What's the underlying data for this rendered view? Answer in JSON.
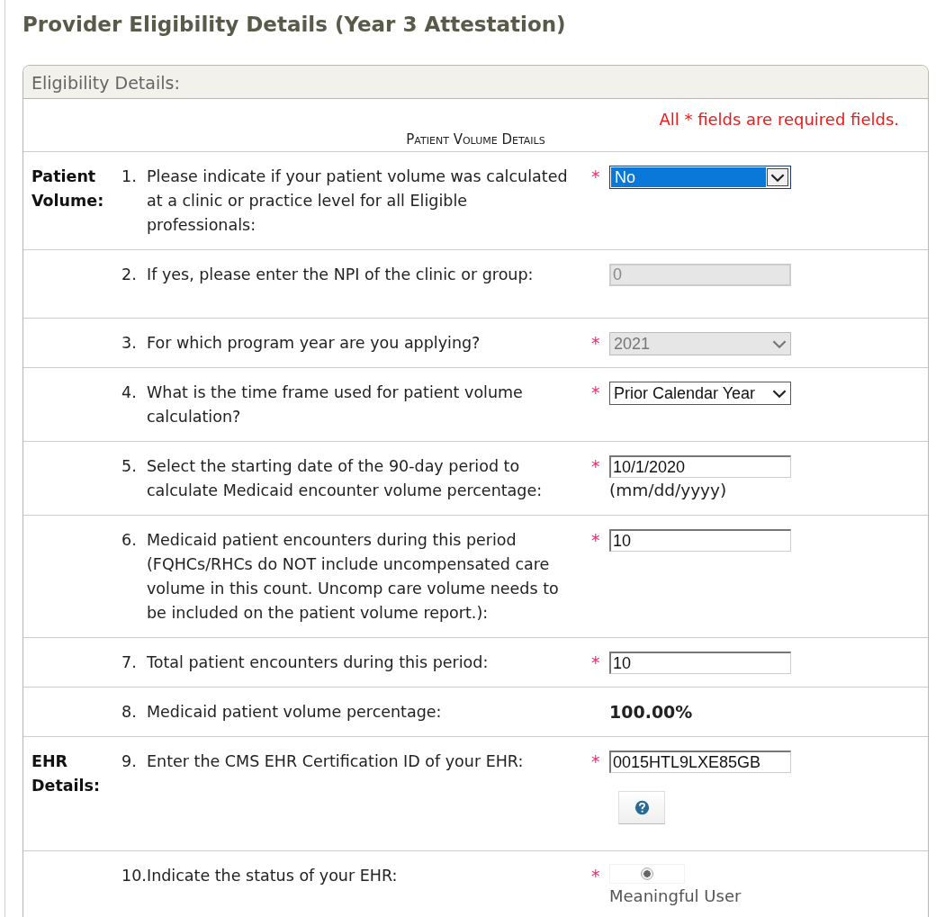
{
  "page_title": "Provider Eligibility Details (Year 3 Attestation)",
  "panel": {
    "title": "Eligibility Details:",
    "required_note": "All * fields are required fields.",
    "section_heading": "Patient Volume Details",
    "rows": [
      {
        "section": "Patient Volume:",
        "number": "1.",
        "question": "Please indicate if your patient volume was calculated at a clinic or practice level for all Eligible professionals:",
        "required_mark": "*",
        "control": {
          "kind": "select",
          "value": "No",
          "disabled": false,
          "focused": true
        }
      },
      {
        "number": "2.",
        "question": "If yes, please enter the NPI of the clinic or group:",
        "control": {
          "kind": "text",
          "value": "0",
          "disabled": true
        }
      },
      {
        "number": "3.",
        "question": "For which program year are you applying?",
        "required_mark": "*",
        "control": {
          "kind": "select",
          "value": "2021",
          "disabled": true,
          "focused": false
        }
      },
      {
        "number": "4.",
        "question": "What is the time frame used for patient volume calculation?",
        "required_mark": "*",
        "control": {
          "kind": "select",
          "value": "Prior Calendar Year",
          "disabled": false,
          "focused": false
        }
      },
      {
        "number": "5.",
        "question": "Select the starting date of the 90-day period to calculate Medicaid encounter volume percentage:",
        "required_mark": "*",
        "control": {
          "kind": "text",
          "value": "10/1/2020",
          "disabled": false,
          "hint": "(mm/dd/yyyy)"
        }
      },
      {
        "number": "6.",
        "question": "Medicaid patient encounters during this period (FQHCs/RHCs do NOT include uncompensated care volume in this count. Uncomp care volume needs to be included on the patient volume report.):",
        "required_mark": "*",
        "control": {
          "kind": "text",
          "value": "10",
          "disabled": false
        }
      },
      {
        "number": "7.",
        "question": "Total patient encounters during this period:",
        "required_mark": "*",
        "control": {
          "kind": "text",
          "value": "10",
          "disabled": false
        }
      },
      {
        "number": "8.",
        "question": "Medicaid patient volume percentage:",
        "control": {
          "kind": "static",
          "value": "100.00%"
        }
      },
      {
        "section": "EHR Details:",
        "number": "9.",
        "question": "Enter the CMS EHR Certification ID of your EHR:",
        "required_mark": "*",
        "control": {
          "kind": "text",
          "value": "0015HTL9LXE85GB",
          "disabled": false,
          "help_button": true
        }
      },
      {
        "number": "10.",
        "question": "Indicate the status of your EHR:",
        "required_mark": "*",
        "control": {
          "kind": "radio",
          "label": "Meaningful User",
          "selected": true
        }
      }
    ]
  }
}
